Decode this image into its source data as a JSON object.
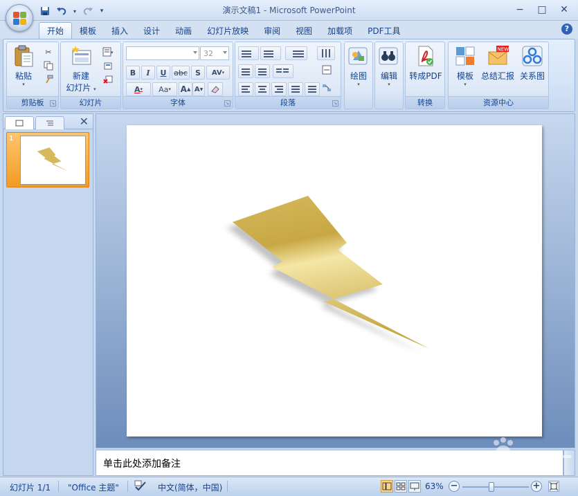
{
  "window": {
    "title": "演示文稿1 - Microsoft PowerPoint",
    "controls": {
      "minimize": "−",
      "maximize": "□",
      "close": "✕"
    }
  },
  "quick_access": {
    "save_icon": "save-icon",
    "undo_icon": "undo-icon",
    "redo_icon": "redo-icon",
    "customize_icon": "customize-qat-icon"
  },
  "tabs": [
    {
      "label": "开始",
      "active": true
    },
    {
      "label": "模板"
    },
    {
      "label": "插入"
    },
    {
      "label": "设计"
    },
    {
      "label": "动画"
    },
    {
      "label": "幻灯片放映"
    },
    {
      "label": "审阅"
    },
    {
      "label": "视图"
    },
    {
      "label": "加载项"
    },
    {
      "label": "PDF工具"
    }
  ],
  "ribbon": {
    "clipboard": {
      "label": "剪贴板",
      "paste": "粘贴"
    },
    "slides": {
      "label": "幻灯片",
      "new_slide_1": "新建",
      "new_slide_2": "幻灯片"
    },
    "font": {
      "label": "字体",
      "font_name": "",
      "font_size": "32",
      "bold": "B",
      "italic": "I",
      "underline": "U",
      "strike": "abc",
      "shadow": "S",
      "spacing": "AV",
      "color": "A",
      "case": "Aa",
      "grow": "A",
      "shrink": "A"
    },
    "paragraph": {
      "label": "段落"
    },
    "drawing": {
      "label": "绘图"
    },
    "editing": {
      "label": "编辑"
    },
    "convert": {
      "label": "转换",
      "to_pdf": "转成PDF"
    },
    "resources": {
      "label": "资源中心",
      "template": "模板",
      "summary": "总结汇报",
      "relation": "关系图",
      "new_badge": "NEW"
    }
  },
  "slides_panel": {
    "slide_number": "1",
    "close": "✕"
  },
  "notes": {
    "placeholder": "单击此处添加备注"
  },
  "status": {
    "slide": "幻灯片 1/1",
    "theme": "\"Office 主题\"",
    "language": "中文(简体，中国)",
    "zoom": "63%",
    "zoom_fraction": 0.44
  },
  "colors": {
    "bolt_light": "#f4e6a6",
    "bolt_mid": "#d6b95c",
    "bolt_dark": "#c8a845"
  }
}
